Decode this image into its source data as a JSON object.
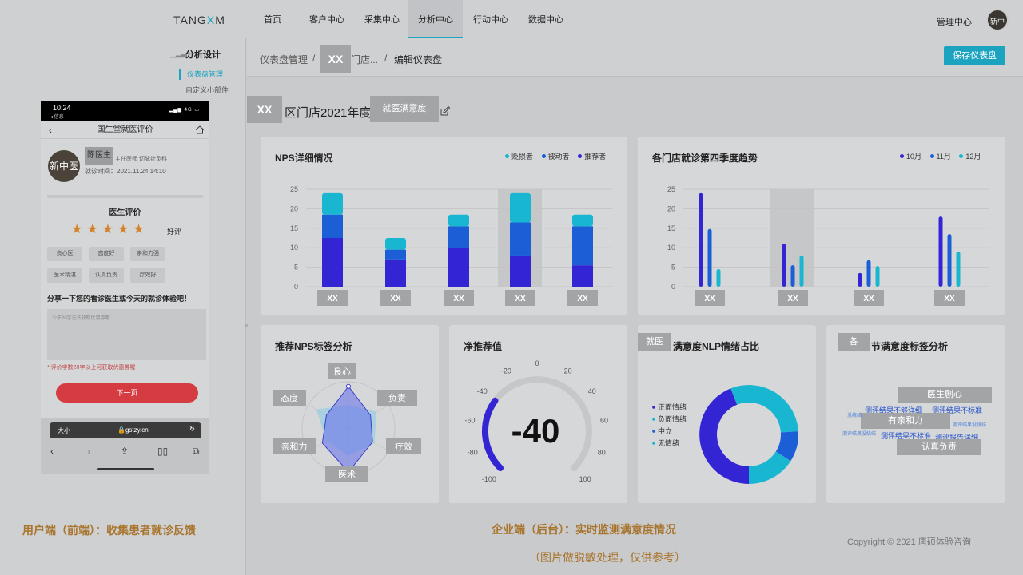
{
  "nav": {
    "logo_left": "TANG",
    "logo_x": "X",
    "logo_right": "M",
    "items": [
      "首页",
      "客户中心",
      "采集中心",
      "分析中心",
      "行动中心",
      "数据中心"
    ],
    "active": "分析中心",
    "admin": "管理中心",
    "avatar_text": "新中医"
  },
  "sidebar": {
    "title": "分析设计",
    "items": [
      "仪表盘管理",
      "自定义小部件"
    ],
    "active": "仪表盘管理"
  },
  "phone": {
    "time": "10:24",
    "back_small": "◂ 信息",
    "signal": "4G",
    "header": "国生堂就医评价",
    "avatar_text": "新中医",
    "doctor_name": "陈医生",
    "doctor_title": "主任医师 切脉针灸科",
    "visit_time": "就诊时间：2021.11.24 14:10",
    "eval_title": "医生评价",
    "rating": 5,
    "rating_label": "好评",
    "tags": [
      "良心医",
      "态度好",
      "亲和力强",
      "医术精湛",
      "认真负责",
      "疗效好"
    ],
    "share_prompt": "分享一下您的看诊医生或今天的就诊体验吧！",
    "textarea_placeholder": "少于20字无法获取优惠券哦",
    "note": "* 评价字数20字以上可获取优惠券喔",
    "next_button": "下一页",
    "browser_aa": "大小",
    "url": "gstzy.cn"
  },
  "captions": {
    "left": "用户端（前端）：收集患者就诊反馈",
    "mid": "企业端（后台）：实时监测满意度情况",
    "sub": "（图片做脱敏处理，仅供参考）",
    "copyright": "Copyright © 2021 唐硕体验咨询"
  },
  "breadcrumb": {
    "first": "仪表盘管理",
    "sep": "/",
    "mask": "XX",
    "second": "门店...",
    "third": "编辑仪表盘",
    "save": "保存仪表盘"
  },
  "dashboard": {
    "mask1": "XX",
    "title": "区门店2021年度",
    "mask2": "就医满意度"
  },
  "colors": {
    "accent": "#1ba3c0",
    "detractor": "#18b6d0",
    "passive": "#1b5ed6",
    "promoter": "#3425d4",
    "oct": "#3425d4",
    "nov": "#1b5ed6",
    "dec": "#18b6d0"
  },
  "cards": {
    "nps_detail": {
      "title": "NPS详细情况",
      "legend": [
        "贬损者",
        "被动者",
        "推荐者"
      ]
    },
    "trend": {
      "title": "各门店就诊第四季度趋势",
      "legend": [
        "10月",
        "11月",
        "12月"
      ]
    },
    "radar": {
      "title": "推荐NPS标签分析"
    },
    "gauge": {
      "title": "净推荐值"
    },
    "donut": {
      "mask": "就医",
      "title": "满意度NLP情绪占比"
    },
    "cloud": {
      "mask": "各",
      "title": "节满意度标签分析"
    }
  },
  "chart_data": [
    {
      "type": "bar",
      "title": "NPS详细情况",
      "stacked": true,
      "categories": [
        "XX",
        "XX",
        "XX",
        "XX",
        "XX"
      ],
      "ylim": [
        0,
        25
      ],
      "yticks": [
        0,
        5,
        10,
        15,
        20,
        25
      ],
      "series": [
        {
          "name": "推荐者",
          "values": [
            12.5,
            7,
            10,
            8,
            5.5
          ]
        },
        {
          "name": "被动者",
          "values": [
            6,
            2.5,
            5.5,
            8.5,
            10
          ]
        },
        {
          "name": "贬损者",
          "values": [
            5.5,
            3,
            3,
            7.5,
            3
          ]
        }
      ]
    },
    {
      "type": "bar",
      "title": "各门店就诊第四季度趋势",
      "categories": [
        "XX",
        "XX",
        "XX",
        "XX"
      ],
      "ylim": [
        0,
        25
      ],
      "yticks": [
        0,
        5,
        10,
        15,
        20,
        25
      ],
      "series": [
        {
          "name": "10月",
          "values": [
            24,
            11,
            3.5,
            18
          ]
        },
        {
          "name": "11月",
          "values": [
            14.8,
            5.5,
            6.8,
            13.5
          ]
        },
        {
          "name": "12月",
          "values": [
            4.5,
            8,
            5.3,
            9
          ]
        }
      ]
    },
    {
      "type": "radar",
      "title": "推荐NPS标签分析",
      "axes": [
        "良心",
        "负责",
        "疗效",
        "医术",
        "亲和力",
        "态度"
      ],
      "series": [
        {
          "values": [
            0.9,
            0.55,
            0.6,
            0.95,
            0.65,
            0.55
          ]
        },
        {
          "values": [
            0.5,
            0.7,
            0.65,
            0.6,
            0.55,
            0.8
          ]
        }
      ]
    },
    {
      "type": "gauge",
      "title": "净推荐值",
      "value": -40,
      "value_label": "-40",
      "range": [
        -100,
        100
      ],
      "ticks": [
        "-100",
        "-80",
        "-60",
        "-40",
        "-20",
        "0",
        "20",
        "40",
        "60",
        "80",
        "100"
      ]
    },
    {
      "type": "pie",
      "title": "满意度NLP情绪占比",
      "labels": [
        "正面情绪",
        "负面情绪",
        "中立",
        "无情绪"
      ],
      "values": [
        44,
        30,
        10,
        16
      ]
    },
    {
      "type": "wordcloud",
      "words": [
        {
          "text": "医生剧心",
          "masked": true
        },
        {
          "text": "测评结果不够详细",
          "masked": false
        },
        {
          "text": "测评结果不标准",
          "masked": false
        },
        {
          "text": "有亲和力",
          "masked": true
        },
        {
          "text": "测评结果不标准",
          "masked": false
        },
        {
          "text": "测评报告详细",
          "masked": false
        },
        {
          "text": "认真负责",
          "masked": true
        },
        {
          "text": "没统结",
          "masked": false
        },
        {
          "text": "测评结果没统结",
          "masked": false
        },
        {
          "text": "测评结果没统结",
          "masked": false
        }
      ]
    }
  ]
}
